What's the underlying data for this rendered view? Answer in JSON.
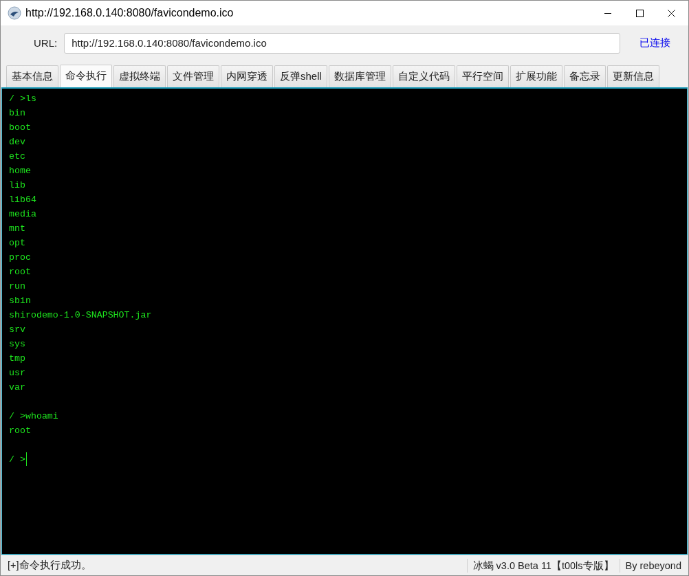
{
  "window": {
    "title": "http://192.168.0.140:8080/favicondemo.ico"
  },
  "url_bar": {
    "label": "URL:",
    "value": "http://192.168.0.140:8080/favicondemo.ico",
    "status": "已连接"
  },
  "tabs": [
    {
      "label": "基本信息",
      "selected": false
    },
    {
      "label": "命令执行",
      "selected": true
    },
    {
      "label": "虚拟终端",
      "selected": false
    },
    {
      "label": "文件管理",
      "selected": false
    },
    {
      "label": "内网穿透",
      "selected": false
    },
    {
      "label": "反弹shell",
      "selected": false
    },
    {
      "label": "数据库管理",
      "selected": false
    },
    {
      "label": "自定义代码",
      "selected": false
    },
    {
      "label": "平行空间",
      "selected": false
    },
    {
      "label": "扩展功能",
      "selected": false
    },
    {
      "label": "备忘录",
      "selected": false
    },
    {
      "label": "更新信息",
      "selected": false
    }
  ],
  "terminal": {
    "commands": [
      {
        "prompt": "/ >ls",
        "output": [
          "bin",
          "boot",
          "dev",
          "etc",
          "home",
          "lib",
          "lib64",
          "media",
          "mnt",
          "opt",
          "proc",
          "root",
          "run",
          "sbin",
          "shirodemo-1.0-SNAPSHOT.jar",
          "srv",
          "sys",
          "tmp",
          "usr",
          "var"
        ]
      },
      {
        "prompt": "/ >whoami",
        "output": [
          "root"
        ]
      },
      {
        "prompt": "/ >",
        "cursor": true
      }
    ]
  },
  "status_bar": {
    "message": "[+]命令执行成功。",
    "version": "冰蝎 v3.0 Beta 11【t00ls专版】",
    "author": "By rebeyond"
  }
}
